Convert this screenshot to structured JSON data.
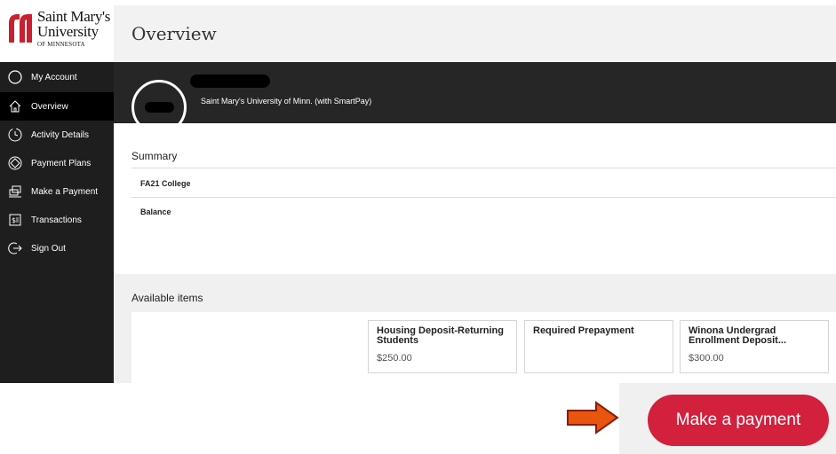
{
  "logo": {
    "line1": "Saint Mary's",
    "line2": "University",
    "line3": "OF MINNESOTA"
  },
  "header": {
    "title": "Overview"
  },
  "sidebar": {
    "items": [
      {
        "label": "My Account",
        "icon": "user-circle-icon"
      },
      {
        "label": "Overview",
        "icon": "home-icon"
      },
      {
        "label": "Activity Details",
        "icon": "clock-icon"
      },
      {
        "label": "Payment Plans",
        "icon": "plans-icon"
      },
      {
        "label": "Make a Payment",
        "icon": "payment-icon"
      },
      {
        "label": "Transactions",
        "icon": "transactions-icon"
      },
      {
        "label": "Sign Out",
        "icon": "sign-out-icon"
      }
    ],
    "active": "Overview"
  },
  "profile": {
    "school": "Saint Mary's University of Minn. (with SmartPay)"
  },
  "summary": {
    "title": "Summary",
    "term": "FA21 College",
    "balance_label": "Balance"
  },
  "available": {
    "title": "Available items",
    "items": [
      {
        "name": "Housing Deposit-Returning Students",
        "price": "$250.00"
      },
      {
        "name": "Required Prepayment",
        "price": ""
      },
      {
        "name": "Winona Undergrad Enrollment Deposit...",
        "price": "$300.00"
      }
    ]
  },
  "payment": {
    "button_label": "Make a payment"
  },
  "colors": {
    "accent": "#d3213d",
    "sidebar": "#1e1e1e",
    "arrow": "#e8550f"
  }
}
